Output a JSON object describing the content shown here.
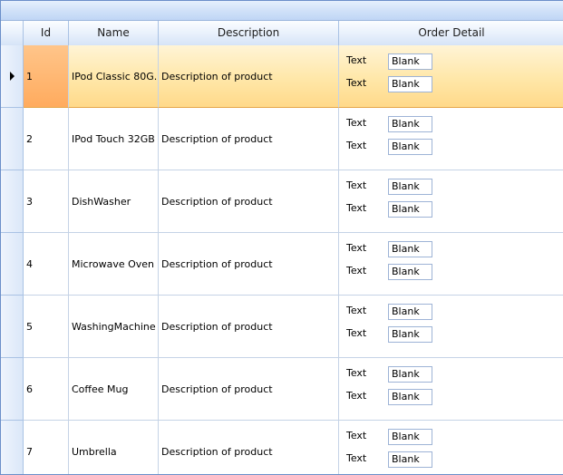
{
  "columns": {
    "id": "Id",
    "name": "Name",
    "description": "Description",
    "order_detail": "Order Detail"
  },
  "rows": [
    {
      "id": "1",
      "name": "IPod  Classic  80G...",
      "description": "Description of product",
      "label1": "Text",
      "value1": "Blank",
      "label2": "Text",
      "value2": "Blank"
    },
    {
      "id": "2",
      "name": "IPod Touch 32GB",
      "description": "Description of product",
      "label1": "Text",
      "value1": "Blank",
      "label2": "Text",
      "value2": "Blank"
    },
    {
      "id": "3",
      "name": "DishWasher",
      "description": "Description of product",
      "label1": "Text",
      "value1": "Blank",
      "label2": "Text",
      "value2": "Blank"
    },
    {
      "id": "4",
      "name": "Microwave Oven",
      "description": "Description of product",
      "label1": "Text",
      "value1": "Blank",
      "label2": "Text",
      "value2": "Blank"
    },
    {
      "id": "5",
      "name": "WashingMachine",
      "description": "Description of product",
      "label1": "Text",
      "value1": "Blank",
      "label2": "Text",
      "value2": "Blank"
    },
    {
      "id": "6",
      "name": "Coffee Mug",
      "description": "Description of product",
      "label1": "Text",
      "value1": "Blank",
      "label2": "Text",
      "value2": "Blank"
    },
    {
      "id": "7",
      "name": "Umbrella",
      "description": "Description of product",
      "label1": "Text",
      "value1": "Blank",
      "label2": "Text",
      "value2": "Blank"
    }
  ],
  "selected_row": 0
}
